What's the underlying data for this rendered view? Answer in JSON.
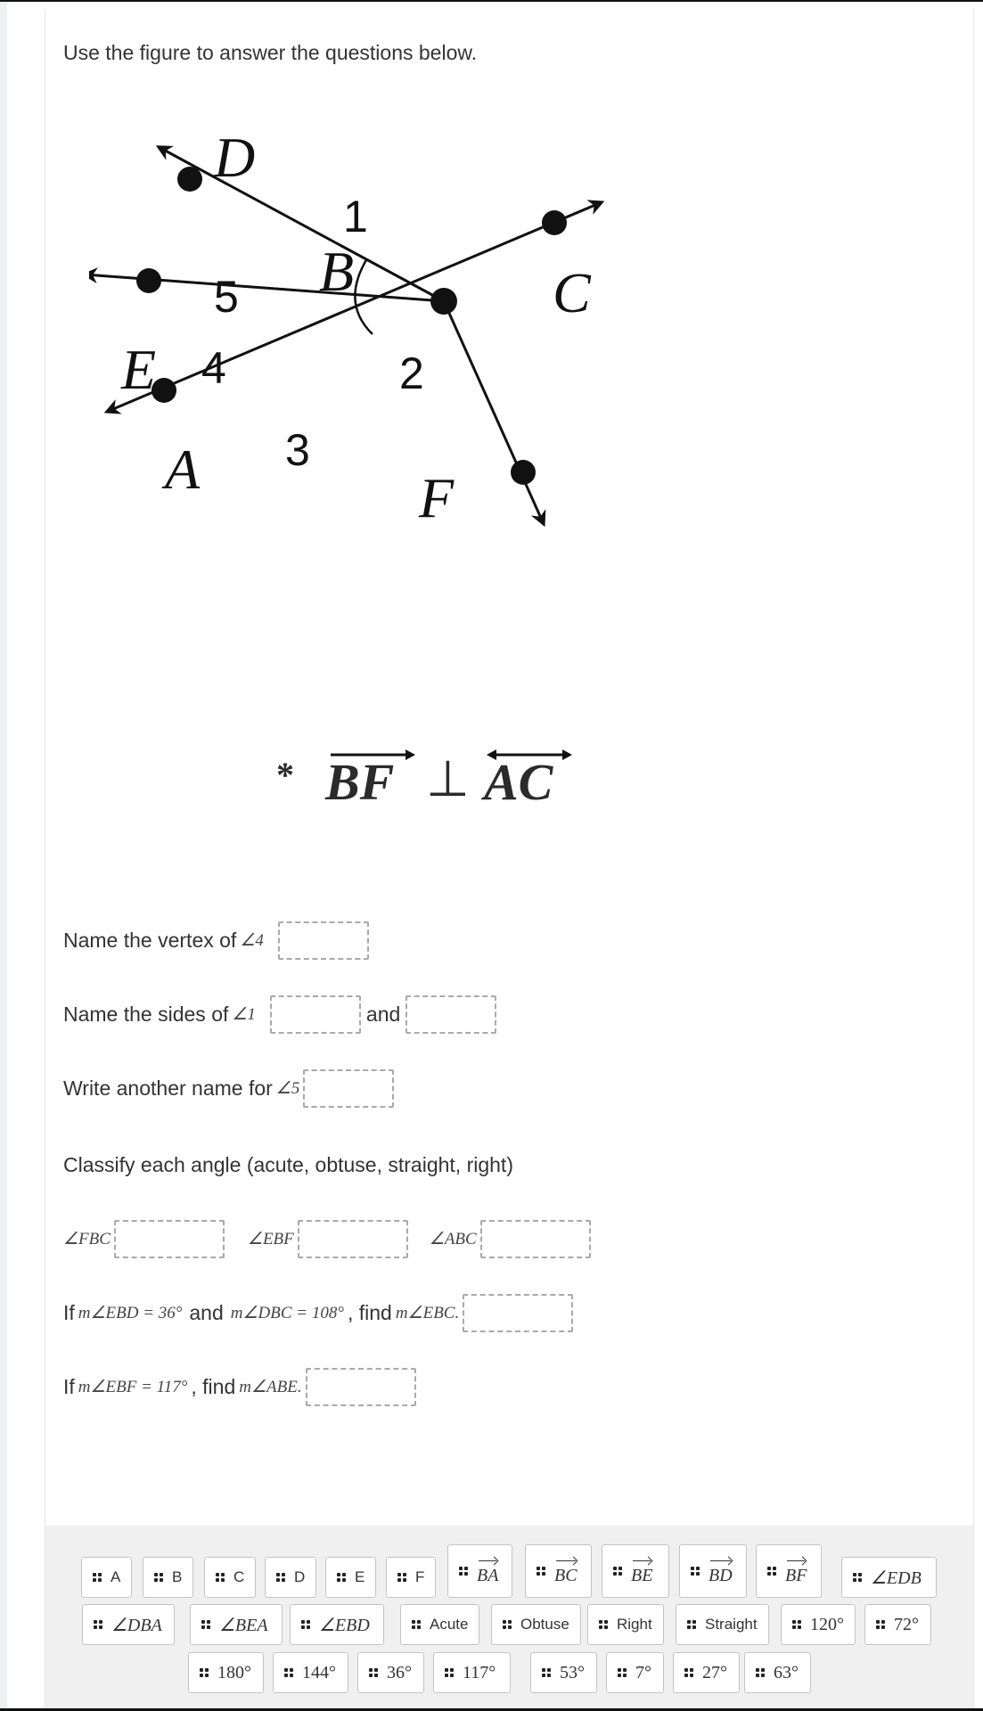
{
  "instructions": "Use the figure to answer the questions below.",
  "figure": {
    "points": [
      "D",
      "B",
      "C",
      "E",
      "A",
      "F"
    ],
    "angle_numbers": [
      "1",
      "2",
      "3",
      "4",
      "5"
    ],
    "given": {
      "star": "*",
      "ray": "BF",
      "symbol": "⊥",
      "line": "AC"
    }
  },
  "questions": {
    "q1": {
      "text": "Name the vertex of",
      "angle": "∠4"
    },
    "q2": {
      "text": "Name the sides of",
      "angle": "∠1",
      "joiner": "and"
    },
    "q3": {
      "text": "Write another name for",
      "angle": "∠5"
    },
    "q4": {
      "text": "Classify each angle (acute, obtuse, straight, right)",
      "angles": [
        "∠FBC",
        "∠EBF",
        "∠ABC"
      ]
    },
    "q5": {
      "prefix": "If",
      "given1": "m∠EBD = 36°",
      "joiner": "and",
      "given2": "m∠DBC = 108°",
      "find_word": ", find",
      "target": "m∠EBC."
    },
    "q6": {
      "prefix": "If",
      "given1": "m∠EBF = 117°",
      "find_word": ", find",
      "target": "m∠ABE."
    }
  },
  "tiles": {
    "row1": [
      {
        "label": "A",
        "kind": "sans"
      },
      {
        "label": "B",
        "kind": "sans"
      },
      {
        "label": "C",
        "kind": "sans"
      },
      {
        "label": "D",
        "kind": "sans"
      },
      {
        "label": "E",
        "kind": "sans"
      },
      {
        "label": "F",
        "kind": "sans"
      },
      {
        "label": "BA",
        "kind": "ray"
      },
      {
        "label": "BC",
        "kind": "ray"
      },
      {
        "label": "BE",
        "kind": "ray"
      },
      {
        "label": "BD",
        "kind": "ray"
      },
      {
        "label": "BF",
        "kind": "ray"
      },
      {
        "label": "∠EDB",
        "kind": "math"
      }
    ],
    "row2": [
      {
        "label": "∠DBA",
        "kind": "math"
      },
      {
        "label": "∠BEA",
        "kind": "math"
      },
      {
        "label": "∠EBD",
        "kind": "math"
      },
      {
        "label": "Acute",
        "kind": "sans"
      },
      {
        "label": "Obtuse",
        "kind": "sans"
      },
      {
        "label": "Right",
        "kind": "sans"
      },
      {
        "label": "Straight",
        "kind": "sans"
      },
      {
        "label": "120°",
        "kind": "num"
      },
      {
        "label": "72°",
        "kind": "num"
      }
    ],
    "row3": [
      {
        "label": "180°",
        "kind": "num"
      },
      {
        "label": "144°",
        "kind": "num"
      },
      {
        "label": "36°",
        "kind": "num"
      },
      {
        "label": "117°",
        "kind": "num"
      },
      {
        "label": "53°",
        "kind": "num"
      },
      {
        "label": "7°",
        "kind": "num"
      },
      {
        "label": "27°",
        "kind": "num"
      },
      {
        "label": "63°",
        "kind": "num"
      }
    ]
  },
  "colors": {
    "tray_bg": "#f0f0f0",
    "drop_border": "#a9a9a9",
    "tile_border": "#c4c4c4"
  }
}
